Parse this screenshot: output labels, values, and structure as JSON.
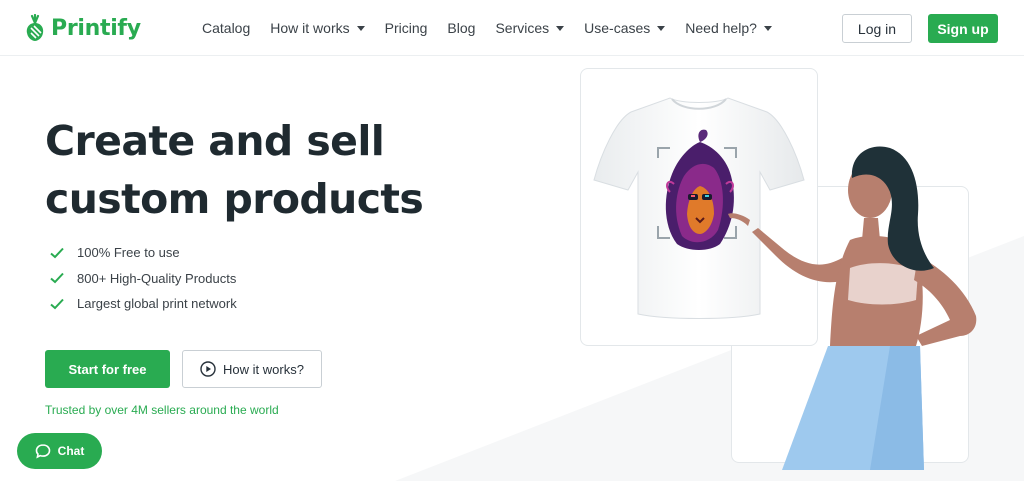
{
  "brand": {
    "name": "Printify",
    "color": "#29ab51"
  },
  "nav": {
    "items": [
      {
        "label": "Catalog",
        "dropdown": false
      },
      {
        "label": "How it works",
        "dropdown": true
      },
      {
        "label": "Pricing",
        "dropdown": false
      },
      {
        "label": "Blog",
        "dropdown": false
      },
      {
        "label": "Services",
        "dropdown": true
      },
      {
        "label": "Use-cases",
        "dropdown": true
      },
      {
        "label": "Need help?",
        "dropdown": true
      }
    ],
    "login_label": "Log in",
    "signup_label": "Sign up"
  },
  "hero": {
    "title": "Create and sell custom products",
    "features": [
      "100% Free to use",
      "800+ High-Quality Products",
      "Largest global print network"
    ],
    "cta_primary": "Start for free",
    "cta_secondary": "How it works?",
    "trusted": "Trusted by over 4M sellers around the world"
  },
  "chat": {
    "label": "Chat"
  },
  "illustration": {
    "product": "t-shirt with lion design",
    "icons": [
      "check-icon",
      "play-circle-icon",
      "chat-bubble-icon",
      "printify-logo-icon"
    ]
  }
}
